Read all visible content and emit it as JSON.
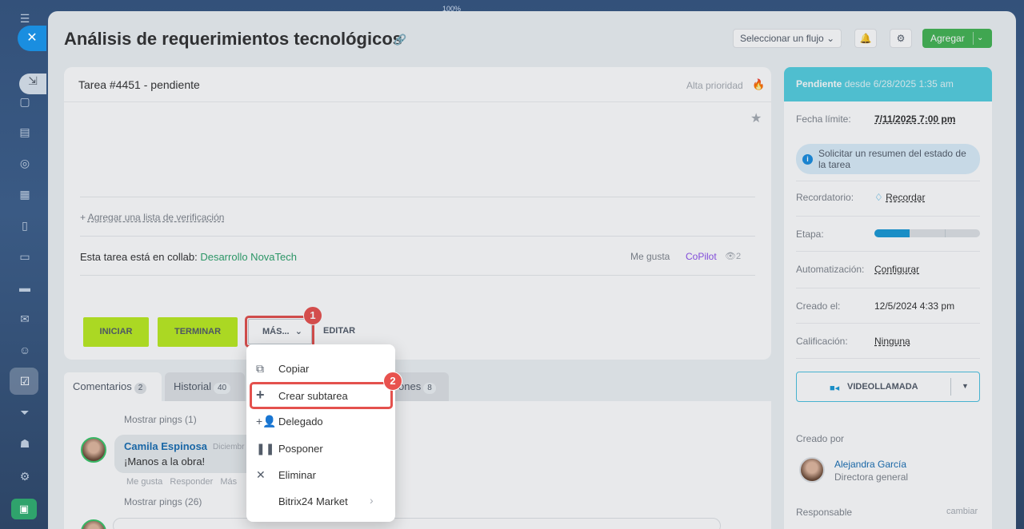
{
  "browser": {
    "zoom": "100%"
  },
  "header": {
    "title": "Análisis de requerimientos tecnológicos",
    "flow_select": "Seleccionar un flujo ⌄",
    "add_label": "Agregar"
  },
  "task": {
    "number_status": "Tarea #4451 - pendiente",
    "priority": "Alta prioridad",
    "checklist_link": "Agregar una lista de verificación",
    "collab_prefix": "Esta tarea está en collab:",
    "collab_name": "Desarrollo NovaTech",
    "like": "Me gusta",
    "copilot": "CoPilot",
    "views": "2",
    "buttons": {
      "start": "INICIAR",
      "finish": "TERMINAR",
      "more": "MÁS...",
      "edit": "EDITAR"
    }
  },
  "tabs": [
    {
      "label": "Comentarios",
      "count": "2"
    },
    {
      "label": "Historial",
      "count": "40"
    },
    {
      "label": "ones",
      "count": "8"
    }
  ],
  "comments": {
    "show_pings_1": "Mostrar pings (1)",
    "author": "Camila Espinosa",
    "date": "Diciembr",
    "text": "¡Manos a la obra!",
    "actions": "Me gusta   Responder   Más",
    "show_pings_2": "Mostrar pings (26)"
  },
  "menu": {
    "items": [
      {
        "label": "Copiar",
        "icon": "copy-icon"
      },
      {
        "label": "Crear subtarea",
        "icon": "plus-icon"
      },
      {
        "label": "Delegado",
        "icon": "delegate-icon"
      },
      {
        "label": "Posponer",
        "icon": "pause-icon"
      },
      {
        "label": "Eliminar",
        "icon": "close-icon"
      },
      {
        "label": "Bitrix24 Market",
        "icon": ""
      }
    ]
  },
  "annotations": {
    "badge1": "1",
    "badge2": "2",
    "color": "#e8524e"
  },
  "sidebar": {
    "status": "Pendiente",
    "status_since": "desde 6/28/2025 1:35 am",
    "deadline_label": "Fecha límite:",
    "deadline_value": "7/11/2025 7:00 pm",
    "ai_text": "Solicitar un resumen del estado de la tarea",
    "reminder_label": "Recordatorio:",
    "reminder_value": "Recordar",
    "stage_label": "Etapa:",
    "stage_progress": 0.33,
    "automation_label": "Automatización:",
    "automation_value": "Configurar",
    "created_label": "Creado el:",
    "created_value": "12/5/2024 4:33 pm",
    "rating_label": "Calificación:",
    "rating_value": "Ninguna",
    "video_call": "VIDEOLLAMADA",
    "created_by_label": "Creado por",
    "creator_name": "Alejandra García",
    "creator_role": "Directora general",
    "responsible_label": "Responsable",
    "change": "cambiar",
    "header_color": "#55d0e0"
  }
}
